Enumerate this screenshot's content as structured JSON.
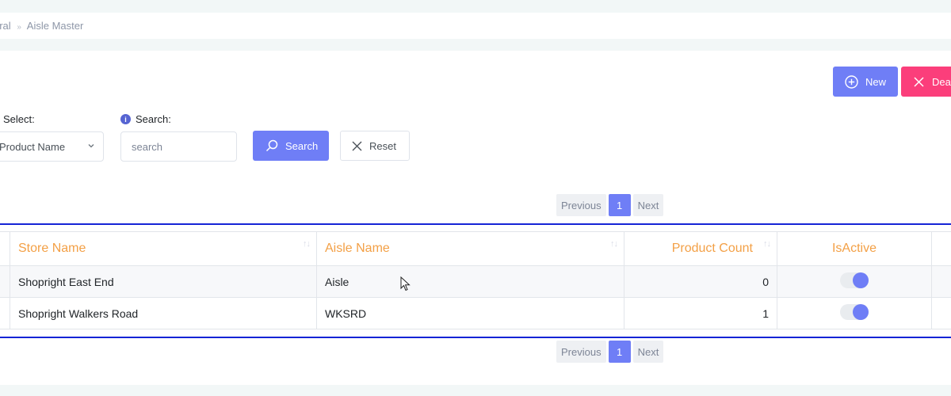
{
  "breadcrumb": {
    "parent": "eral",
    "separator": "»",
    "current": "Aisle Master"
  },
  "actions": {
    "new_label": "New",
    "deactivate_label": "Dea"
  },
  "filters": {
    "select_label": "Select:",
    "select_value": "Product Name",
    "search_label": "Search:",
    "search_placeholder": "search",
    "search_button": "Search",
    "reset_button": "Reset"
  },
  "pagination": {
    "previous": "Previous",
    "current_page": "1",
    "next": "Next"
  },
  "table": {
    "columns": [
      "Store Name",
      "Aisle Name",
      "Product Count",
      "IsActive"
    ],
    "rows": [
      {
        "store": "Shopright East End",
        "aisle": "Aisle",
        "count": "0",
        "active": true
      },
      {
        "store": "Shopright Walkers Road",
        "aisle": "WKSRD",
        "count": "1",
        "active": true
      }
    ]
  },
  "colors": {
    "primary": "#6f7ef6",
    "danger": "#fb3e7b",
    "header_text": "#f3a046",
    "rule": "#1524d6"
  }
}
